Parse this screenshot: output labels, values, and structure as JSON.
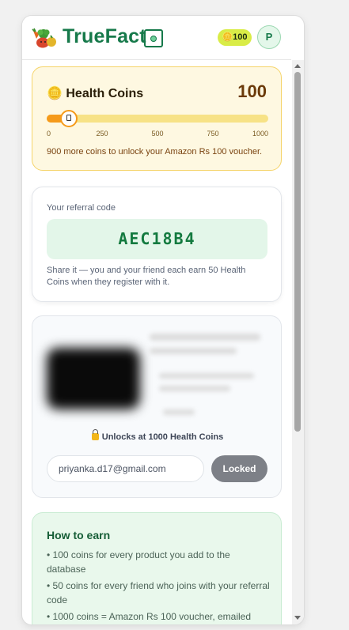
{
  "header": {
    "brand": "TrueFact",
    "coin_badge": "🪙100",
    "avatar_initial": "P"
  },
  "coins": {
    "title": "🪙 Health Coins",
    "total": "100",
    "progress_value": 100,
    "progress_max": 1000,
    "ticks": [
      "0",
      "250",
      "500",
      "750",
      "1000"
    ],
    "message": "900 more coins to unlock your Amazon Rs 100 voucher."
  },
  "referral": {
    "label": "Your referral code",
    "code": "AEC18B4",
    "description": "Share it — you and your friend each earn 50 Health Coins when they register with it."
  },
  "voucher": {
    "lock_text": "Unlocks at 1000 Health Coins",
    "email_value": "priyanka.d17@gmail.com",
    "button_label": "Locked"
  },
  "howto": {
    "title": "How to earn",
    "items": [
      "• 100 coins for every product you add to the database",
      "• 50 coins for every friend who joins with your referral code",
      "• 1000 coins = Amazon Rs 100 voucher, emailed"
    ]
  },
  "colors": {
    "brand_green": "#16794a",
    "coin_orange": "#f59a1a",
    "badge_lime": "#d9ec47"
  }
}
